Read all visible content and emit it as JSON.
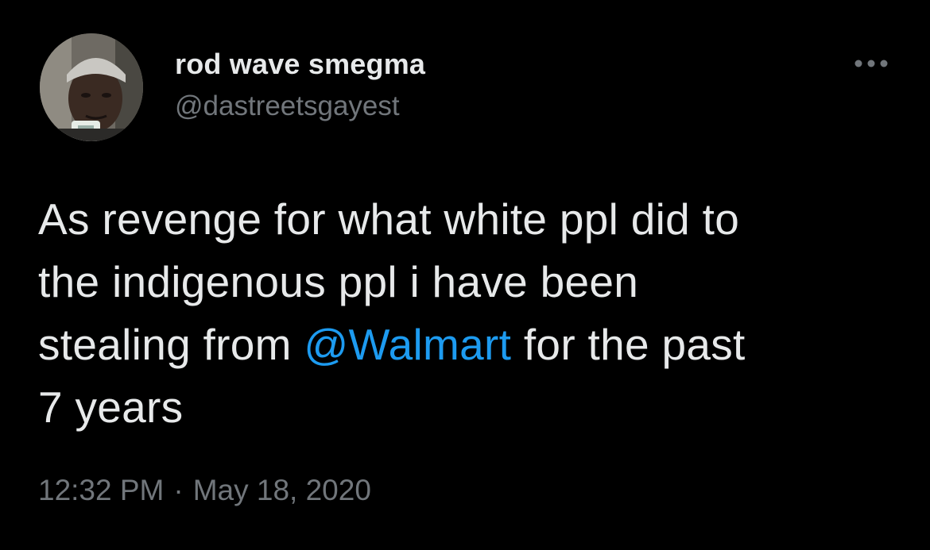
{
  "colors": {
    "background": "#000000",
    "primary_text": "#e7e9ea",
    "secondary_text": "#71767b",
    "link": "#1d9bf0"
  },
  "author": {
    "display_name": "rod wave smegma",
    "handle": "@dastreetsgayest",
    "avatar_icon": "profile-photo"
  },
  "menu": {
    "icon": "more-horizontal-icon"
  },
  "tweet": {
    "lines": [
      [
        "As revenge for what white ppl did to"
      ],
      [
        "the indigenous ppl i have been"
      ],
      [
        "stealing from ",
        "@Walmart",
        " for the past"
      ],
      [
        "7 years"
      ]
    ],
    "mention": "@Walmart"
  },
  "meta": {
    "time": "12:32 PM",
    "separator": "·",
    "date": "May 18, 2020"
  }
}
